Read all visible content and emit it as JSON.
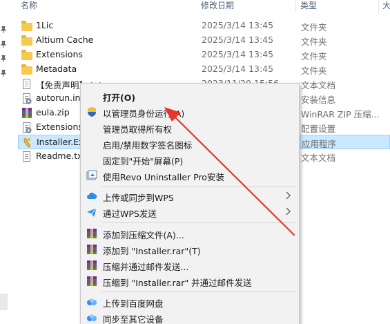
{
  "columns": {
    "name": "名称",
    "date": "修改日期",
    "type": "类型",
    "size": "大"
  },
  "files": [
    {
      "name": "1Lic",
      "date": "2025/3/14 13:45",
      "type": "文件夹",
      "icon": "folder-icon"
    },
    {
      "name": "Altium Cache",
      "date": "2025/3/14 13:45",
      "type": "文件夹",
      "icon": "folder-icon"
    },
    {
      "name": "Extensions",
      "date": "2025/3/14 13:45",
      "type": "文件夹",
      "icon": "folder-icon"
    },
    {
      "name": "Metadata",
      "date": "2025/3/14 13:45",
      "type": "文件夹",
      "icon": "folder-icon"
    },
    {
      "name": "【免责声明】.txt",
      "date": "2023/11/20 15:56",
      "type": "文本文档",
      "icon": "text-file-icon"
    },
    {
      "name": "autorun.inf",
      "date": "",
      "type": "安装信息",
      "icon": "settings-file-icon"
    },
    {
      "name": "eula.zip",
      "date": "",
      "type": "WinRAR ZIP 压缩...",
      "icon": "winrar-icon"
    },
    {
      "name": "Extensions",
      "date": "",
      "type": "配置设置",
      "icon": "settings-file-icon"
    },
    {
      "name": "Installer.Ex",
      "date": "",
      "type": "应用程序",
      "icon": "installer-icon",
      "selected": true
    },
    {
      "name": "Readme.txt",
      "date": "",
      "type": "文本文档",
      "icon": "text-file-icon"
    }
  ],
  "context_menu": {
    "groups": [
      [
        {
          "label": "打开(O)",
          "bold": true,
          "icon": ""
        },
        {
          "label": "以管理员身份运行(A)",
          "icon": "uac-shield-icon"
        },
        {
          "label": "管理员取得所有权",
          "icon": ""
        },
        {
          "label": "启用/禁用数字签名图标",
          "icon": ""
        },
        {
          "label": "固定到\"开始\"屏幕(P)",
          "icon": ""
        },
        {
          "label": "使用Revo Uninstaller Pro安装",
          "icon": "revo-uninstaller-icon"
        }
      ],
      [
        {
          "label": "上传或同步到WPS",
          "icon": "wps-cloud-icon",
          "submenu": true
        },
        {
          "label": "通过WPS发送",
          "icon": "wps-send-icon",
          "submenu": true
        }
      ],
      [
        {
          "label": "添加到压缩文件(A)...",
          "icon": "winrar-icon"
        },
        {
          "label": "添加到 \"Installer.rar\"(T)",
          "icon": "winrar-icon"
        },
        {
          "label": "压缩并通过邮件发送...",
          "icon": "winrar-icon"
        },
        {
          "label": "压缩到 \"Installer.rar\" 并通过邮件发送",
          "icon": "winrar-icon"
        }
      ],
      [
        {
          "label": "上传到百度网盘",
          "icon": "baidu-netdisk-icon"
        },
        {
          "label": "同步至其它设备",
          "icon": "baidu-sync-icon"
        }
      ]
    ]
  },
  "colors": {
    "selection_bg": "#cce8ff",
    "menu_bg": "#f2f2f2",
    "annotation_arrow": "#e8352c"
  }
}
